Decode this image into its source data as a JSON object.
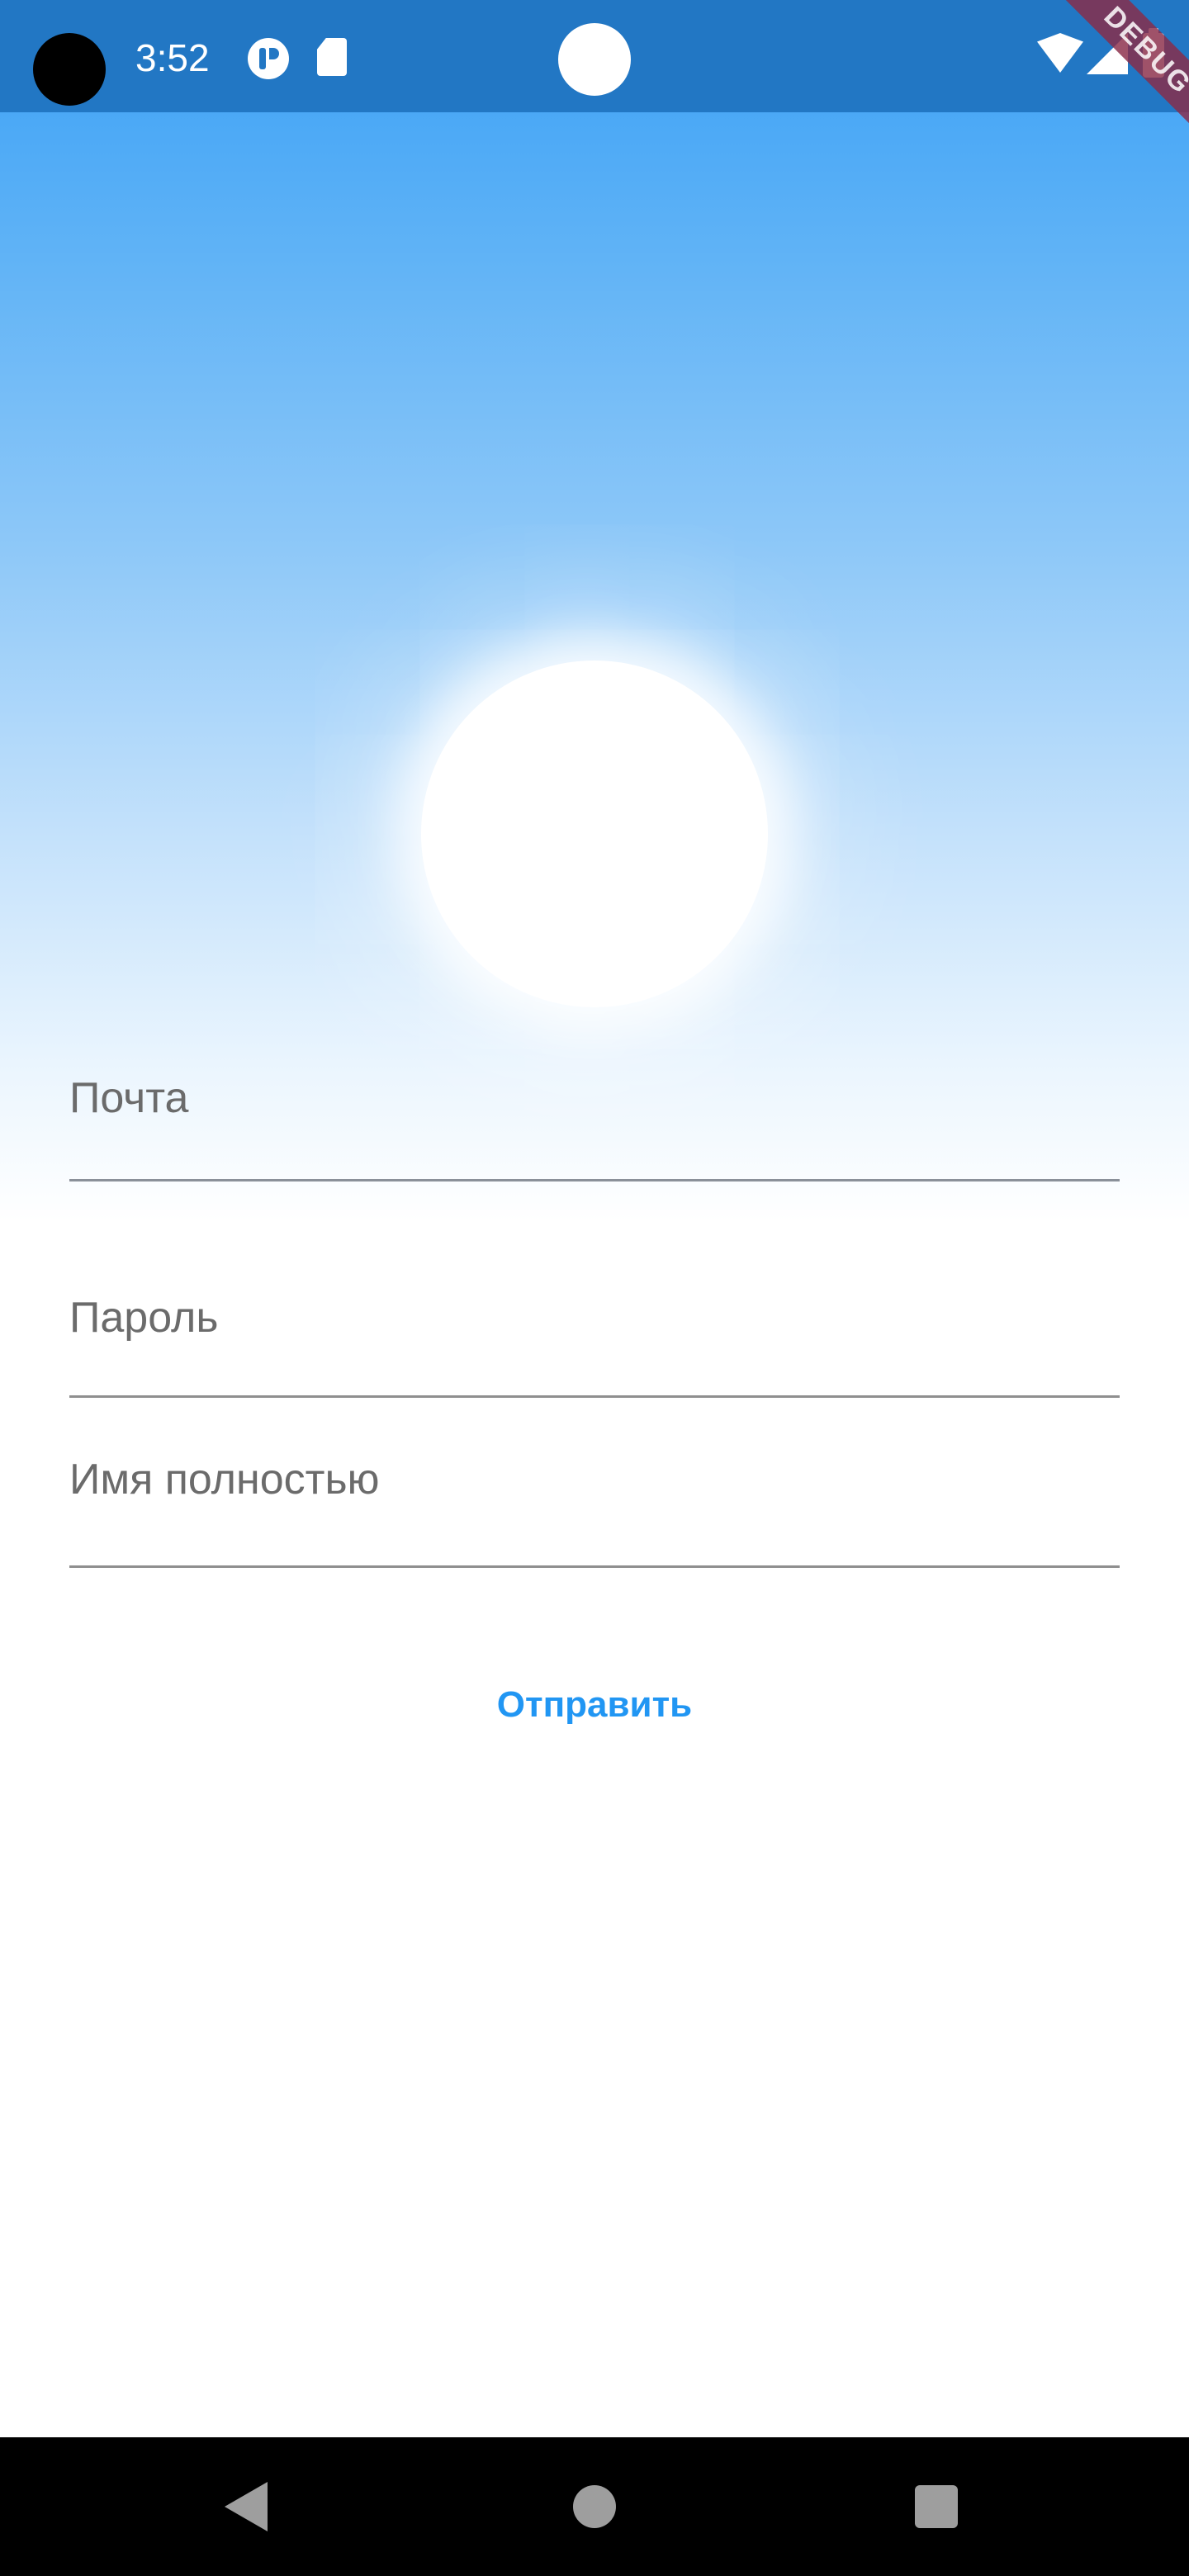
{
  "status_bar": {
    "time": "3:52"
  },
  "debug_banner": {
    "label": "DEBUG"
  },
  "form": {
    "email_label": "Почта",
    "password_label": "Пароль",
    "fullname_label": "Имя полностью",
    "submit_label": "Отправить"
  },
  "colors": {
    "accent": "#2196f3",
    "status_bar": "#2277c4",
    "sky_top": "#3aa0f5"
  },
  "icons": {
    "status": [
      "camera-cutout-icon",
      "app-notification-icon",
      "sd-card-icon",
      "front-camera-icon",
      "wifi-icon",
      "cell-signal-icon",
      "battery-icon"
    ],
    "navigation": [
      "back-icon",
      "home-icon",
      "recents-icon"
    ]
  }
}
